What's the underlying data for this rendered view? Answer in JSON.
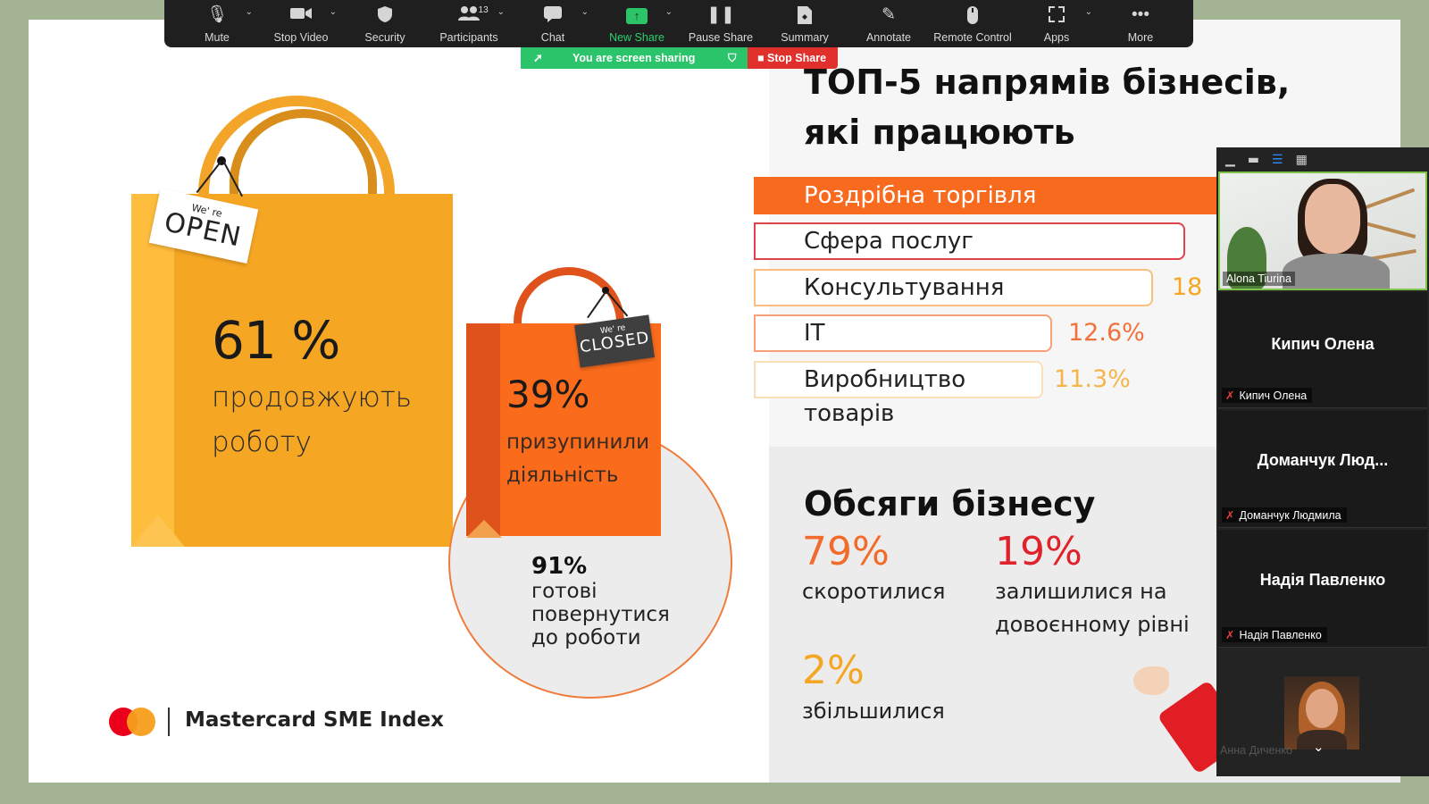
{
  "toolbar": {
    "items": [
      {
        "label": "Mute",
        "icon": "microphone-icon"
      },
      {
        "label": "Stop Video",
        "icon": "video-camera-icon"
      },
      {
        "label": "Security",
        "icon": "shield-icon"
      },
      {
        "label": "Participants",
        "icon": "participants-icon",
        "count": "13"
      },
      {
        "label": "Chat",
        "icon": "chat-bubble-icon"
      },
      {
        "label": "New Share",
        "icon": "share-screen-icon"
      },
      {
        "label": "Pause Share",
        "icon": "pause-icon"
      },
      {
        "label": "Summary",
        "icon": "summary-document-icon"
      },
      {
        "label": "Annotate",
        "icon": "pencil-icon"
      },
      {
        "label": "Remote Control",
        "icon": "mouse-icon"
      },
      {
        "label": "Apps",
        "icon": "apps-icon"
      },
      {
        "label": "More",
        "icon": "more-dots-icon"
      }
    ]
  },
  "sharing": {
    "status": "You are screen sharing",
    "stop_label": "Stop Share"
  },
  "slide": {
    "open_tag": {
      "small": "We' re",
      "big": "OPEN"
    },
    "closed_tag": {
      "small": "We' re",
      "big": "CLOSED"
    },
    "open_pct": "61 %",
    "open_text": [
      "продовжують",
      "роботу"
    ],
    "closed_pct": "39%",
    "closed_text": [
      "призупинили",
      "діяльність"
    ],
    "return_pct": "91%",
    "return_text": [
      "готові",
      "повернутися",
      "до роботи"
    ],
    "brand": "Mastercard SME Index",
    "top_title": [
      "ТОП-5 напрямів бізнесів,",
      "які працюють"
    ],
    "top_bars": [
      {
        "label": "Роздрібна торгівля",
        "pct": ""
      },
      {
        "label": "Сфера послуг",
        "pct": ""
      },
      {
        "label": "Консультування",
        "pct": "18"
      },
      {
        "label": "IT",
        "pct": "12.6%"
      },
      {
        "label": "Виробництво товарів",
        "pct": "11.3%"
      }
    ],
    "volume_title": "Обсяги бізнесу",
    "volume": [
      {
        "pct": "79%",
        "text": [
          "скоротилися"
        ],
        "color": "#f26b2a"
      },
      {
        "pct": "19%",
        "text": [
          "залишилися на",
          "довоєнному рівні"
        ],
        "color": "#e0222a"
      },
      {
        "pct": "2%",
        "text": [
          "збільшилися"
        ],
        "color": "#f5a623"
      }
    ]
  },
  "panel": {
    "self_video_label": "Alona Tiurina",
    "participants": [
      {
        "display": "Кипич Олена",
        "label": "Кипич Олена"
      },
      {
        "display": "Доманчук Люд...",
        "label": "Доманчук Людмила"
      },
      {
        "display": "Надія Павленко",
        "label": "Надія Павленко"
      }
    ],
    "last_label": "Анна Диченко"
  }
}
